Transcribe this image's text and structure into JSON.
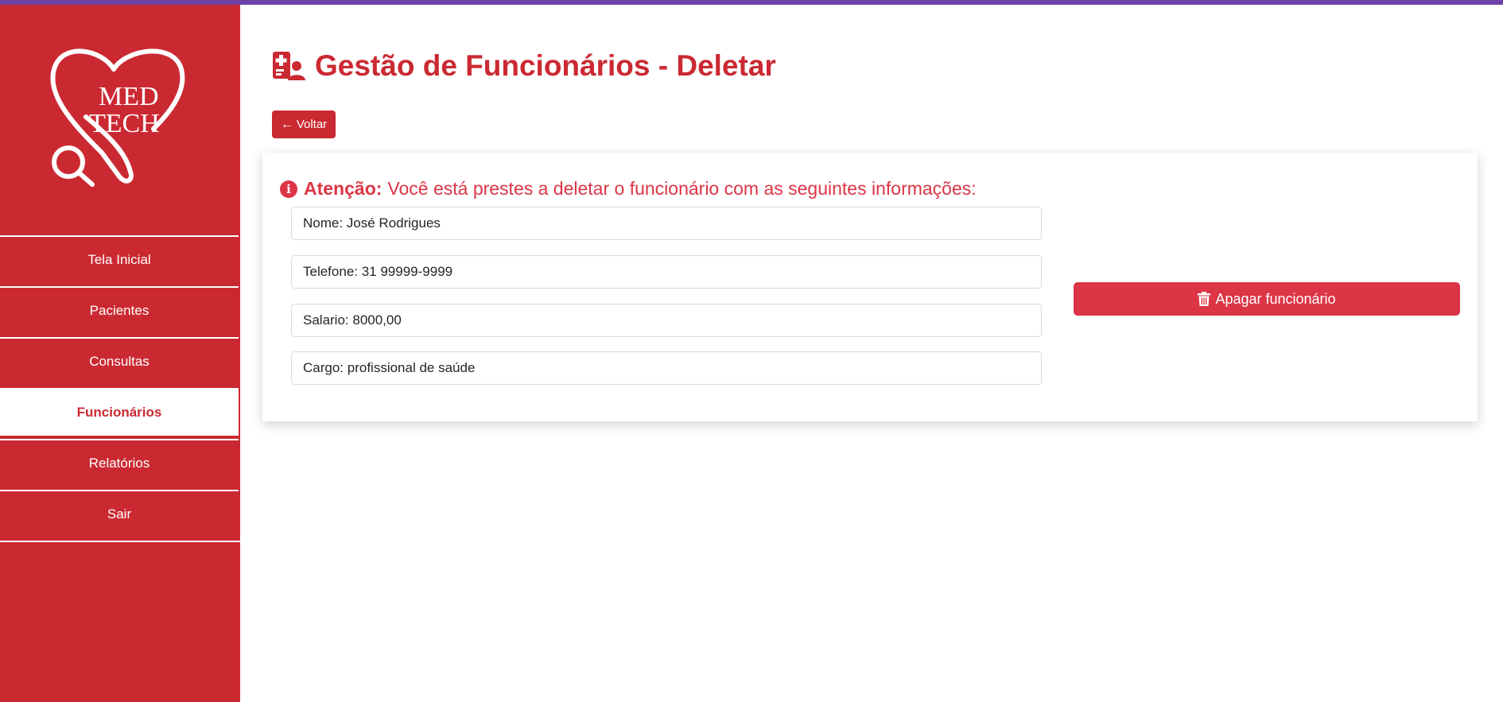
{
  "brand": {
    "logo_line1": "MED",
    "logo_line2": "TECH",
    "accent_color": "#cb2932",
    "top_bar_color": "#6f42a8"
  },
  "sidebar": {
    "items": [
      {
        "label": "Tela Inicial",
        "active": false
      },
      {
        "label": "Pacientes",
        "active": false
      },
      {
        "label": "Consultas",
        "active": false
      },
      {
        "label": "Funcionários",
        "active": true
      },
      {
        "label": "Relatórios",
        "active": false
      },
      {
        "label": "Sair",
        "active": false
      }
    ]
  },
  "header": {
    "icon": "staff-id-icon",
    "title": "Gestão de Funcionários - Deletar",
    "back_label": "Voltar",
    "back_icon": "arrow-left-icon"
  },
  "card": {
    "warning_icon": "info-circle-icon",
    "warning_strong": "Atenção:",
    "warning_text": "Você está prestes a deletar o funcionário com as seguintes informações:",
    "fields": [
      {
        "value": "Nome: José Rodrigues"
      },
      {
        "value": "Telefone: 31 99999-9999"
      },
      {
        "value": "Salario: 8000,00"
      },
      {
        "value": "Cargo: profissional de saúde"
      }
    ],
    "delete_icon": "trash-icon",
    "delete_label": "Apagar funcionário",
    "danger_color": "#dc3545"
  }
}
